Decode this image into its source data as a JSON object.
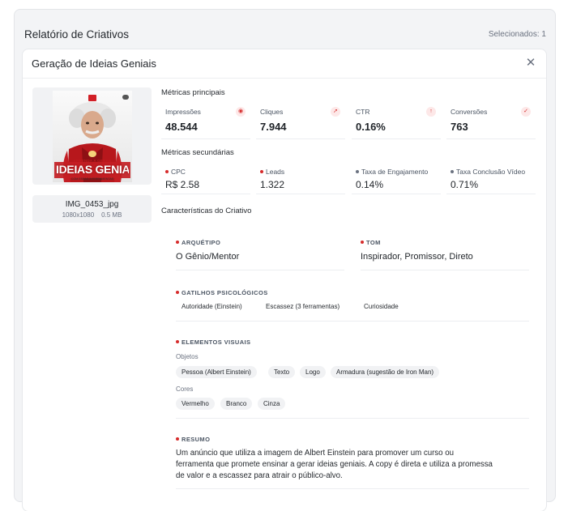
{
  "report": {
    "title": "Relatório de Criativos",
    "selected": "Selecionados: 1"
  },
  "modal": {
    "title": "Geração de Ideias Geniais",
    "close_icon": "close-icon"
  },
  "creative": {
    "poster_small_text": "APRENDA A GERAR",
    "poster_big_text": "IDEIAS GENIAIS",
    "poster_sub_text": "COM ESSAS 3 FERRAMENTAS",
    "file_name": "IMG_0453_jpg",
    "dimensions": "1080x1080",
    "size": "0.5 MB"
  },
  "main_metrics": {
    "title": "Métricas principais",
    "items": [
      {
        "label": "Impressões",
        "value": "48.544",
        "icon": "eye-icon"
      },
      {
        "label": "Cliques",
        "value": "7.944",
        "icon": "cursor-icon"
      },
      {
        "label": "CTR",
        "value": "0.16%",
        "icon": "arrow-up-icon"
      },
      {
        "label": "Conversões",
        "value": "763",
        "icon": "check-icon"
      }
    ]
  },
  "secondary_metrics": {
    "title": "Métricas secundárias",
    "items": [
      {
        "label": "CPC",
        "value": "R$ 2.58",
        "dot_color": "#d62b2b"
      },
      {
        "label": "Leads",
        "value": "1.322",
        "dot_color": "#d62b2b"
      },
      {
        "label": "Taxa de Engajamento",
        "value": "0.14%",
        "dot_color": "#6b7280"
      },
      {
        "label": "Taxa Conclusão Vídeo",
        "value": "0.71%",
        "dot_color": "#6b7280"
      }
    ]
  },
  "characteristics": {
    "title": "Características do Criativo",
    "archetype": {
      "label": "ARQUÉTIPO",
      "value": "O Gênio/Mentor"
    },
    "tone": {
      "label": "TOM",
      "value": "Inspirador, Promissor, Direto"
    },
    "triggers": {
      "label": "GATILHOS PSICOLÓGICOS",
      "tags": [
        "Autoridade (Einstein)",
        "Escassez (3 ferramentas)",
        "Curiosidade"
      ]
    },
    "visual_elements": {
      "label": "ELEMENTOS VISUAIS",
      "objects_label": "Objetos",
      "objects": [
        "Pessoa (Albert Einstein)",
        "Texto",
        "Logo",
        "Armadura (sugestão de Iron Man)"
      ],
      "colors_label": "Cores",
      "colors": [
        "Vermelho",
        "Branco",
        "Cinza"
      ]
    },
    "summary": {
      "label": "RESUMO",
      "line1": "Um anúncio que utiliza a imagem de Albert Einstein para promover um curso ou",
      "line2": "ferramenta que promete ensinar a gerar ideias geniais. A copy é direta e utiliza a promessa",
      "line3": "de valor e a escassez para atrair o público-alvo."
    }
  },
  "colors": {
    "accent": "#d62b2b",
    "poster_red": "#d21f26"
  }
}
